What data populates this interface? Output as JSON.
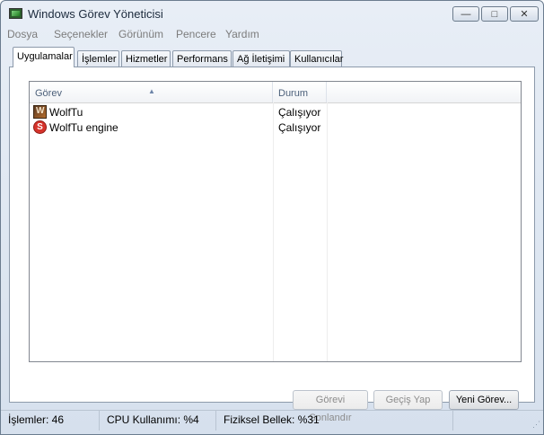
{
  "window": {
    "title": "Windows Görev Yöneticisi"
  },
  "window_controls": {
    "minimize": "—",
    "maximize": "□",
    "close": "✕"
  },
  "menu": [
    "Dosya",
    "Seçenekler",
    "Görünüm",
    "Pencere",
    "Yardım"
  ],
  "tabs": [
    {
      "label": "Uygulamalar",
      "active": true
    },
    {
      "label": "İşlemler",
      "active": false
    },
    {
      "label": "Hizmetler",
      "active": false
    },
    {
      "label": "Performans",
      "active": false
    },
    {
      "label": "Ağ İletişimi",
      "active": false
    },
    {
      "label": "Kullanıcılar",
      "active": false
    }
  ],
  "list": {
    "columns": [
      "Görev",
      "Durum"
    ],
    "rows": [
      {
        "name": "WolfTu",
        "status": "Çalışıyor",
        "icon": "wolf-app-icon"
      },
      {
        "name": "WolfTu engine",
        "status": "Çalışıyor",
        "icon": "s-engine-icon"
      }
    ]
  },
  "buttons": {
    "end_task": "Görevi Sonlandır",
    "switch_to": "Geçiş Yap",
    "new_task": "Yeni Görev..."
  },
  "status": {
    "processes": "İşlemler: 46",
    "cpu": "CPU Kullanımı: %4",
    "memory": "Fiziksel Bellek: %31"
  }
}
